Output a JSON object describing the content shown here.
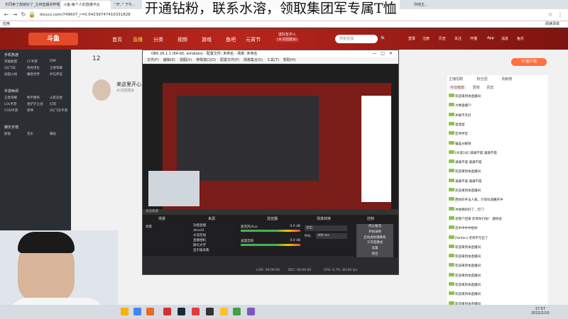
{
  "overlay_text": "开通钻粉，联系水溶，领取集团军专属T恤",
  "browser": {
    "tabs": [
      "乐同卖了放抛好了_主持直播间哔哩哔",
      "斗鱼-每个人的直播平台",
      "“开..” 下午...",
      "你地主..."
    ],
    "url": "douyu.com/749607_r=0.04239747410331828",
    "bookmark": "应用",
    "bookmark_right": "阅读清单"
  },
  "douyu": {
    "logo": "斗鱼",
    "nav": [
      "首页",
      "直播",
      "分类",
      "视频",
      "游戏",
      "鱼吧",
      "元宵节"
    ],
    "search_placeholder": "搜索直播",
    "header_right": [
      "登录",
      "注册",
      "历史",
      "关注",
      "开播",
      "App",
      "消息",
      "鱼乐"
    ],
    "banner_text": "送好友中入",
    "banner_sub": "(水溶团建会)",
    "gift_btn": "PC客户端",
    "follow_count": "12",
    "host_title": "来这里开心",
    "host_sub": "水溶团建会"
  },
  "sidebar": {
    "sections": [
      {
        "title": "手机热游",
        "items": [
          "英雄联盟",
          "CF手游",
          "DNF",
          "QQ飞车",
          "绝地求生",
          "王者荣耀",
          "穿越火线",
          "魔兽世界",
          "炉石传说"
        ]
      },
      {
        "title": "手游休闲",
        "items": [
          "王者荣耀",
          "和平精英",
          "火影忍者",
          "LOL手游",
          "金铲铲之战",
          "幻塔",
          "COD手游",
          "原神",
          "QQ飞车手游"
        ]
      },
      {
        "title": "娱乐天地",
        "items": [
          "颜值",
          "音乐",
          "舞蹈"
        ]
      }
    ]
  },
  "obs": {
    "title": "OBS 26.1.1 (64-bit, windows) - 配置文件: 未命名 - 场景: 未命名",
    "menu": [
      "文件(F)",
      "编辑(E)",
      "视图(V)",
      "停靠窗口(D)",
      "配置文件(P)",
      "场景集合(S)",
      "工具(T)",
      "帮助(H)"
    ],
    "preview_label": "未选择源",
    "panels": [
      "场景",
      "来源",
      "混音器",
      "场景转换",
      "控制"
    ],
    "scenes": [
      "场景"
    ],
    "sources": [
      "功能直播",
      "direct2",
      "水溶无线",
      "直播相机",
      "聊天文字",
      "显示器采集"
    ],
    "mixer": [
      {
        "name": "麦克风/Aux",
        "level": "0.0 dB"
      },
      {
        "name": "桌面音频",
        "level": "0.0 dB"
      }
    ],
    "transition": {
      "type": "淡出",
      "duration_label": "时长",
      "duration": "300 ms"
    },
    "controls": [
      "停止推流",
      "开始录制",
      "启动虚拟摄像机",
      "工作室模式",
      "设置",
      "退出"
    ],
    "status": {
      "live": "LIVE: 00:00:00",
      "rec": "REC: 00:00:00",
      "cpu": "CPU: 6.7%, 60.00 fps"
    }
  },
  "chat": {
    "tabs": [
      "主播招聘",
      "粉丝团",
      "贡献榜"
    ],
    "sub_tabs": [
      "今日榜单",
      "周榜",
      "贵宾"
    ],
    "lines": [
      "欢迎来到本直播间",
      "大棒直播??",
      "冲锋不灭好",
      "溜溜溜",
      "宏伟宇宏",
      "偏差分解呀",
      "[水溶1号] 满满不孤 满满不孤",
      "满满不孤 满满不孤",
      "欢迎来到本直播间",
      "满满不孤 满满不孤",
      "欢迎来到本直播间",
      "西抓的手法人家，只等叫滚撒开冲",
      "冲进啊好好了，打门",
      "老客户回来 老哥你们快！ 都你会",
      "您中冲中冲给你",
      "[fanfan] 老哥不写出了",
      "欢迎来到本直播间",
      "欢迎来到本直播间",
      "欢迎来到本直播间",
      "欢迎来到本直播间",
      "欢迎来到本直播间",
      "欢迎来到本直播间",
      "欢迎来到本直播间"
    ]
  },
  "taskbar": {
    "time": "17:57",
    "date": "2022/2/10"
  },
  "colors": {
    "douyu_red": "#b8261b",
    "obs_bg": "#2b2b2e",
    "chat_level": "#8bc34a"
  }
}
